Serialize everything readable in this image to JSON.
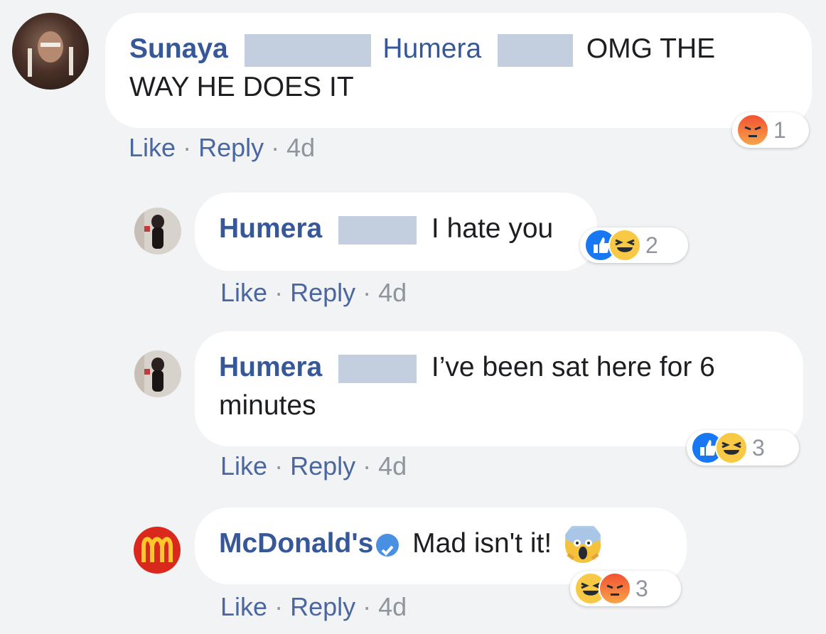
{
  "comments": [
    {
      "author": "Sunaya",
      "mention": "Humera",
      "text_line1": "OMG THE",
      "text_line2": "WAY HE DOES IT",
      "actions": {
        "like": "Like",
        "reply": "Reply",
        "time": "4d",
        "sep": "·"
      },
      "reactions": {
        "types": [
          "angry-icon"
        ],
        "count": "1"
      }
    },
    {
      "author": "Humera",
      "text": "I hate you",
      "actions": {
        "like": "Like",
        "reply": "Reply",
        "time": "4d",
        "sep": "·"
      },
      "reactions": {
        "types": [
          "like-icon",
          "haha-icon"
        ],
        "count": "2"
      }
    },
    {
      "author": "Humera",
      "text_line1": "I’ve been sat here for 6",
      "text_line2": "minutes",
      "actions": {
        "like": "Like",
        "reply": "Reply",
        "time": "4d",
        "sep": "·"
      },
      "reactions": {
        "types": [
          "like-icon",
          "haha-icon"
        ],
        "count": "3"
      }
    },
    {
      "author": "McDonald's",
      "text": "Mad isn't it!",
      "actions": {
        "like": "Like",
        "reply": "Reply",
        "time": "4d",
        "sep": "·"
      },
      "reactions": {
        "types": [
          "haha-icon",
          "angry-icon"
        ],
        "count": "3"
      }
    }
  ],
  "colors": {
    "background": "#f2f3f5",
    "name_blue": "#365899",
    "link_blue": "#4b67a1",
    "meta_gray": "#90949c",
    "redaction": "#c3cede",
    "mcdonalds_red": "#da291c",
    "mcdonalds_yellow": "#ffc72c"
  }
}
